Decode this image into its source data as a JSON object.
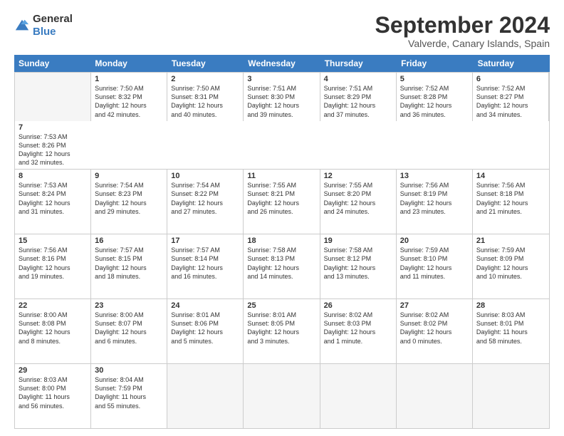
{
  "logo": {
    "general": "General",
    "blue": "Blue"
  },
  "title": "September 2024",
  "location": "Valverde, Canary Islands, Spain",
  "days": [
    "Sunday",
    "Monday",
    "Tuesday",
    "Wednesday",
    "Thursday",
    "Friday",
    "Saturday"
  ],
  "rows": [
    [
      {
        "num": "",
        "text": "",
        "empty": true
      },
      {
        "num": "1",
        "text": "Sunrise: 7:50 AM\nSunset: 8:32 PM\nDaylight: 12 hours\nand 42 minutes.",
        "empty": false
      },
      {
        "num": "2",
        "text": "Sunrise: 7:50 AM\nSunset: 8:31 PM\nDaylight: 12 hours\nand 40 minutes.",
        "empty": false
      },
      {
        "num": "3",
        "text": "Sunrise: 7:51 AM\nSunset: 8:30 PM\nDaylight: 12 hours\nand 39 minutes.",
        "empty": false
      },
      {
        "num": "4",
        "text": "Sunrise: 7:51 AM\nSunset: 8:29 PM\nDaylight: 12 hours\nand 37 minutes.",
        "empty": false
      },
      {
        "num": "5",
        "text": "Sunrise: 7:52 AM\nSunset: 8:28 PM\nDaylight: 12 hours\nand 36 minutes.",
        "empty": false
      },
      {
        "num": "6",
        "text": "Sunrise: 7:52 AM\nSunset: 8:27 PM\nDaylight: 12 hours\nand 34 minutes.",
        "empty": false
      },
      {
        "num": "7",
        "text": "Sunrise: 7:53 AM\nSunset: 8:26 PM\nDaylight: 12 hours\nand 32 minutes.",
        "empty": false
      }
    ],
    [
      {
        "num": "8",
        "text": "Sunrise: 7:53 AM\nSunset: 8:24 PM\nDaylight: 12 hours\nand 31 minutes.",
        "empty": false
      },
      {
        "num": "9",
        "text": "Sunrise: 7:54 AM\nSunset: 8:23 PM\nDaylight: 12 hours\nand 29 minutes.",
        "empty": false
      },
      {
        "num": "10",
        "text": "Sunrise: 7:54 AM\nSunset: 8:22 PM\nDaylight: 12 hours\nand 27 minutes.",
        "empty": false
      },
      {
        "num": "11",
        "text": "Sunrise: 7:55 AM\nSunset: 8:21 PM\nDaylight: 12 hours\nand 26 minutes.",
        "empty": false
      },
      {
        "num": "12",
        "text": "Sunrise: 7:55 AM\nSunset: 8:20 PM\nDaylight: 12 hours\nand 24 minutes.",
        "empty": false
      },
      {
        "num": "13",
        "text": "Sunrise: 7:56 AM\nSunset: 8:19 PM\nDaylight: 12 hours\nand 23 minutes.",
        "empty": false
      },
      {
        "num": "14",
        "text": "Sunrise: 7:56 AM\nSunset: 8:18 PM\nDaylight: 12 hours\nand 21 minutes.",
        "empty": false
      }
    ],
    [
      {
        "num": "15",
        "text": "Sunrise: 7:56 AM\nSunset: 8:16 PM\nDaylight: 12 hours\nand 19 minutes.",
        "empty": false
      },
      {
        "num": "16",
        "text": "Sunrise: 7:57 AM\nSunset: 8:15 PM\nDaylight: 12 hours\nand 18 minutes.",
        "empty": false
      },
      {
        "num": "17",
        "text": "Sunrise: 7:57 AM\nSunset: 8:14 PM\nDaylight: 12 hours\nand 16 minutes.",
        "empty": false
      },
      {
        "num": "18",
        "text": "Sunrise: 7:58 AM\nSunset: 8:13 PM\nDaylight: 12 hours\nand 14 minutes.",
        "empty": false
      },
      {
        "num": "19",
        "text": "Sunrise: 7:58 AM\nSunset: 8:12 PM\nDaylight: 12 hours\nand 13 minutes.",
        "empty": false
      },
      {
        "num": "20",
        "text": "Sunrise: 7:59 AM\nSunset: 8:10 PM\nDaylight: 12 hours\nand 11 minutes.",
        "empty": false
      },
      {
        "num": "21",
        "text": "Sunrise: 7:59 AM\nSunset: 8:09 PM\nDaylight: 12 hours\nand 10 minutes.",
        "empty": false
      }
    ],
    [
      {
        "num": "22",
        "text": "Sunrise: 8:00 AM\nSunset: 8:08 PM\nDaylight: 12 hours\nand 8 minutes.",
        "empty": false
      },
      {
        "num": "23",
        "text": "Sunrise: 8:00 AM\nSunset: 8:07 PM\nDaylight: 12 hours\nand 6 minutes.",
        "empty": false
      },
      {
        "num": "24",
        "text": "Sunrise: 8:01 AM\nSunset: 8:06 PM\nDaylight: 12 hours\nand 5 minutes.",
        "empty": false
      },
      {
        "num": "25",
        "text": "Sunrise: 8:01 AM\nSunset: 8:05 PM\nDaylight: 12 hours\nand 3 minutes.",
        "empty": false
      },
      {
        "num": "26",
        "text": "Sunrise: 8:02 AM\nSunset: 8:03 PM\nDaylight: 12 hours\nand 1 minute.",
        "empty": false
      },
      {
        "num": "27",
        "text": "Sunrise: 8:02 AM\nSunset: 8:02 PM\nDaylight: 12 hours\nand 0 minutes.",
        "empty": false
      },
      {
        "num": "28",
        "text": "Sunrise: 8:03 AM\nSunset: 8:01 PM\nDaylight: 11 hours\nand 58 minutes.",
        "empty": false
      }
    ],
    [
      {
        "num": "29",
        "text": "Sunrise: 8:03 AM\nSunset: 8:00 PM\nDaylight: 11 hours\nand 56 minutes.",
        "empty": false
      },
      {
        "num": "30",
        "text": "Sunrise: 8:04 AM\nSunset: 7:59 PM\nDaylight: 11 hours\nand 55 minutes.",
        "empty": false
      },
      {
        "num": "",
        "text": "",
        "empty": true
      },
      {
        "num": "",
        "text": "",
        "empty": true
      },
      {
        "num": "",
        "text": "",
        "empty": true
      },
      {
        "num": "",
        "text": "",
        "empty": true
      },
      {
        "num": "",
        "text": "",
        "empty": true
      }
    ]
  ]
}
